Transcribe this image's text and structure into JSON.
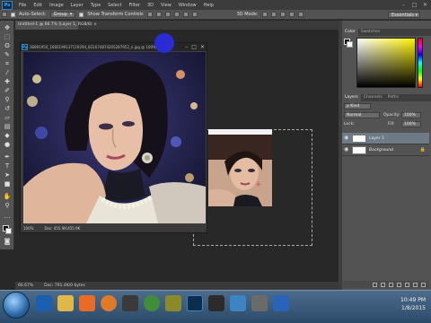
{
  "menu": {
    "logo": "Ps",
    "items": [
      "File",
      "Edit",
      "Image",
      "Layer",
      "Type",
      "Select",
      "Filter",
      "3D",
      "View",
      "Window",
      "Help"
    ],
    "window_controls": [
      "–",
      "□",
      "✕"
    ]
  },
  "options_bar": {
    "auto_select_label": "Auto-Select:",
    "auto_select_target": "Group",
    "show_transform_label": "Show Transform Controls",
    "mode_3d_label": "3D Mode:",
    "workspace": "Essentials"
  },
  "document": {
    "tab_title": "Untitled-1 @ 66.7% (Layer 1, RGB/8) ×",
    "float_title": "36891950_1660199137119294_831674874205287952_n.jpg @ 100% (RGB/8)",
    "float_zoom": "100%",
    "float_doc": "Doc: 455.9K/455.9K",
    "status_zoom": "66.67%",
    "status_doc": "Doc: 791.4K/0 bytes"
  },
  "panels": {
    "color_tabs": [
      "Color",
      "Swatches"
    ],
    "layers_tabs": [
      "Layers",
      "Channels",
      "Paths"
    ],
    "kind": "ρ Kind",
    "blend_mode": "Normal",
    "opacity_label": "Opacity:",
    "opacity_value": "100%",
    "lock_label": "Lock:",
    "fill_label": "Fill:",
    "fill_value": "100%",
    "layers": [
      "Layer 1",
      "Background"
    ]
  },
  "colors": {
    "accent_blue": "#2b2bd6",
    "selected_layer": "#6e7a86"
  },
  "taskbar": {
    "time": "10:49 PM",
    "date": "1/8/2015"
  }
}
